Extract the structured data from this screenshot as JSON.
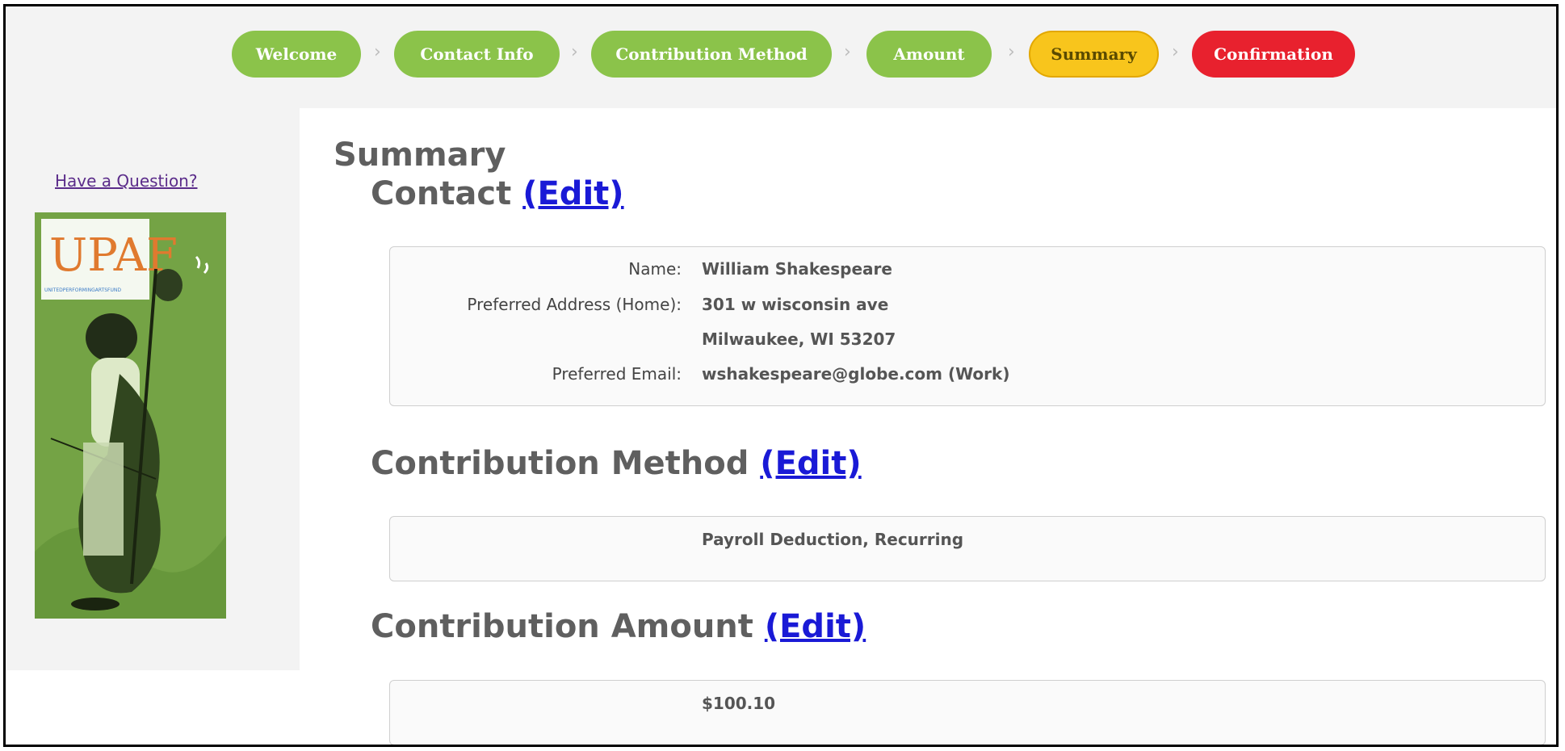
{
  "steps": [
    {
      "label": "Welcome",
      "state": "complete",
      "color": "#8bc34a"
    },
    {
      "label": "Contact Info",
      "state": "complete",
      "color": "#8bc34a"
    },
    {
      "label": "Contribution Method",
      "state": "complete",
      "color": "#8bc34a"
    },
    {
      "label": "Amount",
      "state": "complete",
      "color": "#8bc34a"
    },
    {
      "label": "Summary",
      "state": "current",
      "color": "#f8c51c"
    },
    {
      "label": "Confirmation",
      "state": "upcoming",
      "color": "#e8212e"
    }
  ],
  "step_separator": "›",
  "sidebar": {
    "question_link": "Have a Question?",
    "poster_logo": "UPAF",
    "poster_tagline": "UNITEDPERFORMINGARTSFUND"
  },
  "summary": {
    "title": "Summary",
    "edit_label": "(Edit)",
    "contact": {
      "heading": "Contact",
      "name_label": "Name:",
      "name_value": "William Shakespeare",
      "address_label": "Preferred Address (Home):",
      "address_line1": "301 w wisconsin ave",
      "address_line2": "Milwaukee, WI 53207",
      "email_label": "Preferred Email:",
      "email_value": "wshakespeare@globe.com (Work)"
    },
    "method": {
      "heading": "Contribution Method",
      "value": "Payroll Deduction, Recurring"
    },
    "amount": {
      "heading": "Contribution Amount",
      "value": "$100.10"
    }
  },
  "colors": {
    "complete": "#8bc34a",
    "current": "#f8c51c",
    "upcoming": "#e8212e",
    "link": "#1a1ad6",
    "visited_link": "#5b2c8a"
  }
}
